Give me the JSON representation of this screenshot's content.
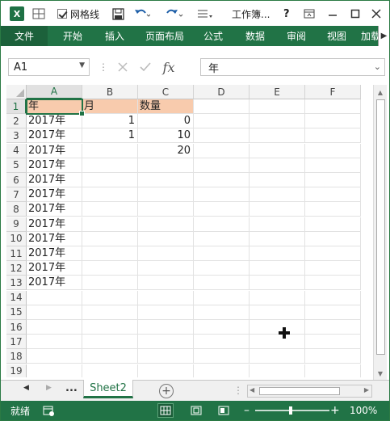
{
  "titlebar": {
    "app_logo": "X",
    "gridlines_label": "网格线",
    "doc_title": "工作簿...",
    "help": "?",
    "icons": [
      "excel-logo",
      "table-icon",
      "checkbox-checked",
      "save-icon",
      "undo-icon",
      "redo-icon",
      "customize-qat-icon",
      "help-icon",
      "ribbon-display-icon",
      "minimize-icon",
      "maximize-icon",
      "close-icon"
    ]
  },
  "ribbon": {
    "tabs": [
      "文件",
      "开始",
      "插入",
      "页面布局",
      "公式",
      "数据",
      "审阅",
      "视图",
      "加载"
    ]
  },
  "formula_bar": {
    "name_box": "A1",
    "fx": "fx",
    "value": "年"
  },
  "grid": {
    "columns": [
      "A",
      "B",
      "C",
      "D",
      "E",
      "F"
    ],
    "rows": [
      "1",
      "2",
      "3",
      "4",
      "5",
      "6",
      "7",
      "8",
      "9",
      "10",
      "11",
      "12",
      "13",
      "14",
      "15",
      "16",
      "17",
      "18",
      "19"
    ],
    "active_cell": "A1",
    "cells": {
      "A1": "年",
      "B1": "月",
      "C1": "数量",
      "A2": "2017年",
      "B2": "1",
      "C2": "0",
      "A3": "2017年",
      "B3": "1",
      "C3": "10",
      "A4": "2017年",
      "C4": "20",
      "A5": "2017年",
      "A6": "2017年",
      "A7": "2017年",
      "A8": "2017年",
      "A9": "2017年",
      "A10": "2017年",
      "A11": "2017年",
      "A12": "2017年",
      "A13": "2017年"
    },
    "header_fill_color": "#f8cbad"
  },
  "sheet_tabs": {
    "ellipsis": "...",
    "active": "Sheet2"
  },
  "status": {
    "ready": "就绪",
    "zoom": "100%",
    "accent": "#217346"
  }
}
